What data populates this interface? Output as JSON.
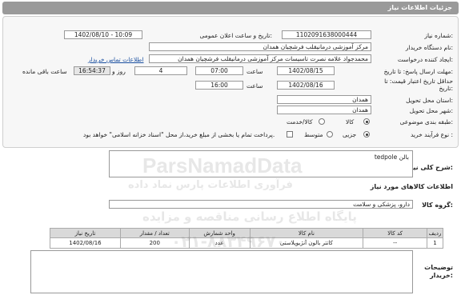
{
  "header": {
    "title": "جزئیات اطلاعات نیاز"
  },
  "form": {
    "need_number_label": "شماره نیاز:",
    "need_number": "1102091638000444",
    "announce_label": "تاریخ و ساعت اعلان عمومی:",
    "announce_value": "1402/08/10 - 10:09",
    "buyer_org_label": "نام دستگاه خریدار:",
    "buyer_org": "مرکز آموزشی درمانیقلب فرشچیان همدان",
    "creator_label": "ایجاد کننده درخواست:",
    "creator": "محمدجواد علامه نصرت تاسیسات مرکز آموزشی درمانیقلب فرشچیان همدان",
    "contact_link": "اطلاعات تماس خریدار",
    "send_deadline_label": "مهلت ارسال پاسخ: تا تاریخ:",
    "send_date": "1402/08/15",
    "time_label": "ساعت",
    "send_time": "07:00",
    "days_value": "4",
    "days_label": "روز و",
    "remaining_time": "16:54:37",
    "remaining_label": "ساعت باقی مانده",
    "validity_label_1": "حداقل تاریخ اعتبار قیمت: تا",
    "validity_label_2": "تاریخ:",
    "validity_date": "1402/08/16",
    "validity_time": "16:00",
    "province_label": "استان محل تحویل:",
    "province": "همدان",
    "city_label": "شهر محل تحویل:",
    "city": "همدان",
    "category_label": "طبقه بندی موضوعی:",
    "category_goods": "کالا",
    "category_goods_service": "کالا/خدمت",
    "purchase_type_label": "نوع فرآیند خرید :",
    "purchase_partial": "جزیی",
    "purchase_medium": "متوسط",
    "payment_note": "پرداخت تمام یا بخشی از مبلغ خرید،از محل \"اسناد خزانه اسلامی\" خواهد بود."
  },
  "description": {
    "label": "شرح کلی نیاز:",
    "value": "بالن tedpole"
  },
  "goods": {
    "section_title": "اطلاعات کالاهای مورد نیاز",
    "group_label": "گروه کالا:",
    "group_value": "دارو، پزشکی و سلامت",
    "columns": [
      "ردیف",
      "کد کالا",
      "نام کالا",
      "واحد شمارش",
      "تعداد / مقدار",
      "تاریخ نیاز"
    ],
    "rows": [
      [
        "1",
        "--",
        "کاتتر بالون آنژیوپلاستی",
        "عدد",
        "200",
        "1402/08/16"
      ]
    ]
  },
  "buyer_notes": {
    "label_1": "توضیحات",
    "label_2": "خریدار:",
    "value": ""
  },
  "watermark": {
    "brand": "ParsNamadData",
    "line1": "پایگاه اطلاع رسانی مناقصه و مزایده",
    "line2": "فرآوری اطلاعات پارس نماد داده",
    "phone": "۰۲۱-۸۸۳۴۹۶۷۰"
  }
}
